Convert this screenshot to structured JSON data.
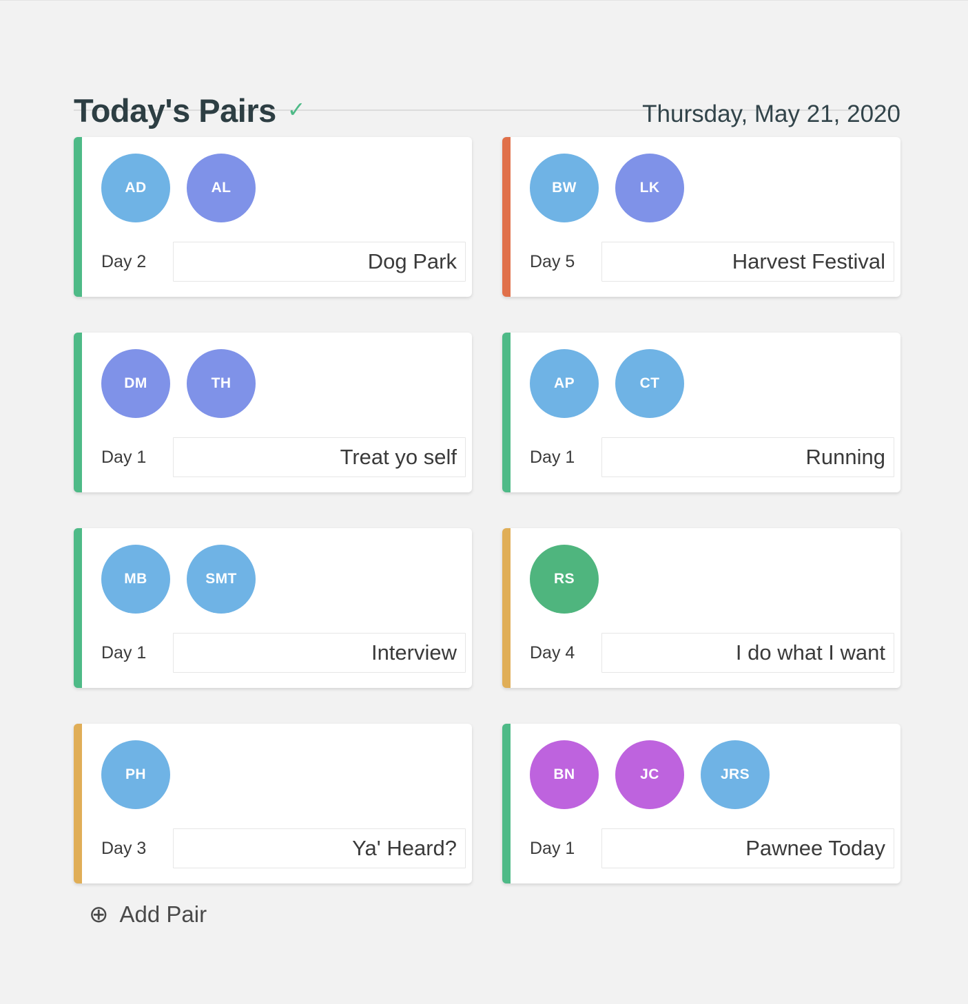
{
  "header": {
    "title": "Today's Pairs",
    "check_icon": "check-icon",
    "date": "Thursday, May 21, 2020"
  },
  "accent_colors": {
    "green": "#4EBA87",
    "orange": "#E0704A",
    "yellow": "#E0AE57"
  },
  "avatar_colors": {
    "blue": "#6FB3E5",
    "indigo": "#7F92E8",
    "magenta": "#BE63DE",
    "green": "#4FB57E"
  },
  "cards": [
    {
      "accent": "green",
      "avatars": [
        {
          "initials": "AD",
          "color": "blue"
        },
        {
          "initials": "AL",
          "color": "indigo"
        }
      ],
      "day": "Day 2",
      "activity": "Dog Park"
    },
    {
      "accent": "orange",
      "avatars": [
        {
          "initials": "BW",
          "color": "blue"
        },
        {
          "initials": "LK",
          "color": "indigo"
        }
      ],
      "day": "Day 5",
      "activity": "Harvest Festival"
    },
    {
      "accent": "green",
      "avatars": [
        {
          "initials": "DM",
          "color": "indigo"
        },
        {
          "initials": "TH",
          "color": "indigo"
        }
      ],
      "day": "Day 1",
      "activity": "Treat yo self"
    },
    {
      "accent": "green",
      "avatars": [
        {
          "initials": "AP",
          "color": "blue"
        },
        {
          "initials": "CT",
          "color": "blue"
        }
      ],
      "day": "Day 1",
      "activity": "Running"
    },
    {
      "accent": "green",
      "avatars": [
        {
          "initials": "MB",
          "color": "blue"
        },
        {
          "initials": "SMT",
          "color": "blue"
        }
      ],
      "day": "Day 1",
      "activity": "Interview"
    },
    {
      "accent": "yellow",
      "avatars": [
        {
          "initials": "RS",
          "color": "green"
        }
      ],
      "day": "Day 4",
      "activity": "I do what I want"
    },
    {
      "accent": "yellow",
      "avatars": [
        {
          "initials": "PH",
          "color": "blue"
        }
      ],
      "day": "Day 3",
      "activity": "Ya' Heard?"
    },
    {
      "accent": "green",
      "avatars": [
        {
          "initials": "BN",
          "color": "magenta"
        },
        {
          "initials": "JC",
          "color": "magenta"
        },
        {
          "initials": "JRS",
          "color": "blue"
        }
      ],
      "day": "Day 1",
      "activity": "Pawnee Today"
    }
  ],
  "add_pair": {
    "icon": "plus-circle-icon",
    "label": "Add Pair"
  }
}
